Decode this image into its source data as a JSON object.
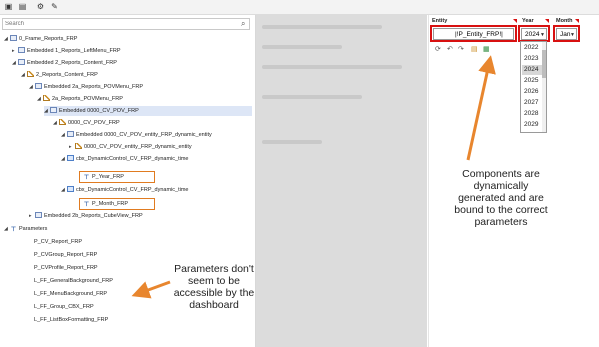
{
  "toolbar": {
    "icons": [
      "save-icon",
      "save-all-icon",
      "run-icon",
      "edit-icon"
    ]
  },
  "search": {
    "placeholder": "Search",
    "icon": "search-icon"
  },
  "tree": [
    {
      "label": "0_Frame_Reports_FRP"
    },
    {
      "label": "Embedded 1_Reports_LeftMenu_FRP"
    },
    {
      "label": "Embedded 2_Reports_Content_FRP"
    },
    {
      "label": "2_Reports_Content_FRP"
    },
    {
      "label": "Embedded 2a_Reports_POVMenu_FRP"
    },
    {
      "label": "2a_Reports_POVMenu_FRP"
    },
    {
      "label": "Embedded 0000_CV_POV_FRP"
    },
    {
      "label": "0000_CV_POV_FRP"
    },
    {
      "label": "Embedded 0000_CV_POV_entity_FRP_dynamic_entity"
    },
    {
      "label": "0000_CV_POV_entity_FRP_dynamic_entity"
    },
    {
      "label": "cbx_DynamicControl_CV_FRP_dynamic_time"
    },
    {
      "label": "P_Year_FRP"
    },
    {
      "label": "cbx_DynamicControl_CV_FRP_dynamic_time"
    },
    {
      "label": "P_Month_FRP"
    },
    {
      "label": "Embedded 2b_Reports_CubeView_FRP"
    },
    {
      "label": "Parameters"
    },
    {
      "label": "P_CV_Report_FRP"
    },
    {
      "label": "P_CVGroup_Report_FRP"
    },
    {
      "label": "P_CVProfile_Report_FRP"
    },
    {
      "label": "L_FF_GeneralBackground_FRP"
    },
    {
      "label": "L_FF_MenuBackground_FRP"
    },
    {
      "label": "L_FF_Group_CBX_FRP"
    },
    {
      "label": "L_FF_ListBoxFormatting_FRP"
    }
  ],
  "dashboard": {
    "entity": {
      "label": "Entity",
      "value": "|!P_Entity_FRP!|"
    },
    "year": {
      "label": "Year",
      "value": "2024",
      "options": [
        "2022",
        "2023",
        "2024",
        "2025",
        "2026",
        "2027",
        "2028",
        "2029"
      ]
    },
    "month": {
      "label": "Month",
      "value": "Jan"
    }
  },
  "annotations": {
    "right": [
      "Components are",
      "dynamically",
      "generated and are",
      "bound to the correct",
      "parameters"
    ],
    "left": [
      "Parameters don't",
      "seem to be",
      "accessible by the",
      "dashboard"
    ]
  },
  "colors": {
    "highlight_box": "#e07b20",
    "red_box": "#d81010",
    "arrow": "#e8862e",
    "selection": "#dde6f6"
  }
}
